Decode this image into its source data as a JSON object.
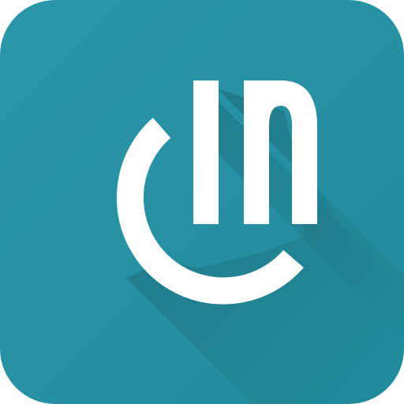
{
  "app_icon": {
    "icon_name": "power-logo-icon",
    "colors": {
      "background": "#218b9c",
      "background_highlight": "#2a97a8",
      "long_shadow": "#1a6672",
      "glyph": "#ffffff"
    }
  }
}
